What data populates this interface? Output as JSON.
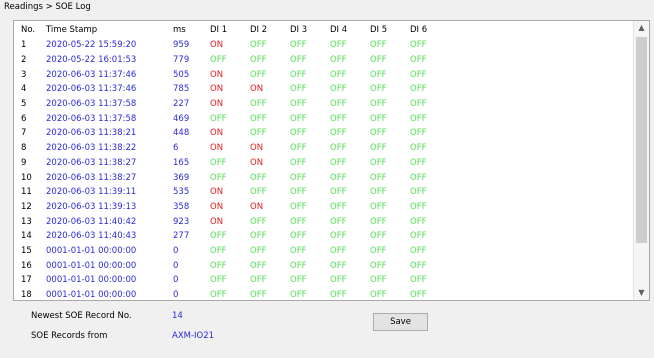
{
  "breadcrumb": "Readings > SOE Log",
  "table": {
    "headers": [
      "No.",
      "Time Stamp",
      "ms",
      "DI 1",
      "DI 2",
      "DI 3",
      "DI 4",
      "DI 5",
      "DI 6"
    ],
    "rows": [
      {
        "no": "1",
        "ts": "2020-05-22 15:59:20",
        "ms": "959",
        "di": [
          "ON",
          "OFF",
          "OFF",
          "OFF",
          "OFF",
          "OFF"
        ]
      },
      {
        "no": "2",
        "ts": "2020-05-22 16:01:53",
        "ms": "779",
        "di": [
          "OFF",
          "OFF",
          "OFF",
          "OFF",
          "OFF",
          "OFF"
        ]
      },
      {
        "no": "3",
        "ts": "2020-06-03 11:37:46",
        "ms": "505",
        "di": [
          "ON",
          "OFF",
          "OFF",
          "OFF",
          "OFF",
          "OFF"
        ]
      },
      {
        "no": "4",
        "ts": "2020-06-03 11:37:46",
        "ms": "785",
        "di": [
          "ON",
          "ON",
          "OFF",
          "OFF",
          "OFF",
          "OFF"
        ]
      },
      {
        "no": "5",
        "ts": "2020-06-03 11:37:58",
        "ms": "227",
        "di": [
          "ON",
          "OFF",
          "OFF",
          "OFF",
          "OFF",
          "OFF"
        ]
      },
      {
        "no": "6",
        "ts": "2020-06-03 11:37:58",
        "ms": "469",
        "di": [
          "OFF",
          "OFF",
          "OFF",
          "OFF",
          "OFF",
          "OFF"
        ]
      },
      {
        "no": "7",
        "ts": "2020-06-03 11:38:21",
        "ms": "448",
        "di": [
          "ON",
          "OFF",
          "OFF",
          "OFF",
          "OFF",
          "OFF"
        ]
      },
      {
        "no": "8",
        "ts": "2020-06-03 11:38:22",
        "ms": "6",
        "di": [
          "ON",
          "ON",
          "OFF",
          "OFF",
          "OFF",
          "OFF"
        ]
      },
      {
        "no": "9",
        "ts": "2020-06-03 11:38:27",
        "ms": "165",
        "di": [
          "OFF",
          "ON",
          "OFF",
          "OFF",
          "OFF",
          "OFF"
        ]
      },
      {
        "no": "10",
        "ts": "2020-06-03 11:38:27",
        "ms": "369",
        "di": [
          "OFF",
          "OFF",
          "OFF",
          "OFF",
          "OFF",
          "OFF"
        ]
      },
      {
        "no": "11",
        "ts": "2020-06-03 11:39:11",
        "ms": "535",
        "di": [
          "ON",
          "OFF",
          "OFF",
          "OFF",
          "OFF",
          "OFF"
        ]
      },
      {
        "no": "12",
        "ts": "2020-06-03 11:39:13",
        "ms": "358",
        "di": [
          "ON",
          "ON",
          "OFF",
          "OFF",
          "OFF",
          "OFF"
        ]
      },
      {
        "no": "13",
        "ts": "2020-06-03 11:40:42",
        "ms": "923",
        "di": [
          "ON",
          "OFF",
          "OFF",
          "OFF",
          "OFF",
          "OFF"
        ]
      },
      {
        "no": "14",
        "ts": "2020-06-03 11:40:43",
        "ms": "277",
        "di": [
          "OFF",
          "OFF",
          "OFF",
          "OFF",
          "OFF",
          "OFF"
        ]
      },
      {
        "no": "15",
        "ts": "0001-01-01 00:00:00",
        "ms": "0",
        "di": [
          "OFF",
          "OFF",
          "OFF",
          "OFF",
          "OFF",
          "OFF"
        ]
      },
      {
        "no": "16",
        "ts": "0001-01-01 00:00:00",
        "ms": "0",
        "di": [
          "OFF",
          "OFF",
          "OFF",
          "OFF",
          "OFF",
          "OFF"
        ]
      },
      {
        "no": "17",
        "ts": "0001-01-01 00:00:00",
        "ms": "0",
        "di": [
          "OFF",
          "OFF",
          "OFF",
          "OFF",
          "OFF",
          "OFF"
        ]
      },
      {
        "no": "18",
        "ts": "0001-01-01 00:00:00",
        "ms": "0",
        "di": [
          "OFF",
          "OFF",
          "OFF",
          "OFF",
          "OFF",
          "OFF"
        ]
      }
    ]
  },
  "scrollbar": {
    "up_icon": "chevron-up-icon",
    "down_icon": "chevron-down-icon"
  },
  "footer": {
    "newest_label": "Newest SOE Record No.",
    "newest_value": "14",
    "from_label": "SOE Records from",
    "from_value": "AXM-IO21",
    "save_label": "Save"
  },
  "colors": {
    "on": "#e0201c",
    "off": "#54e054",
    "value_blue": "#2b2bd6"
  }
}
